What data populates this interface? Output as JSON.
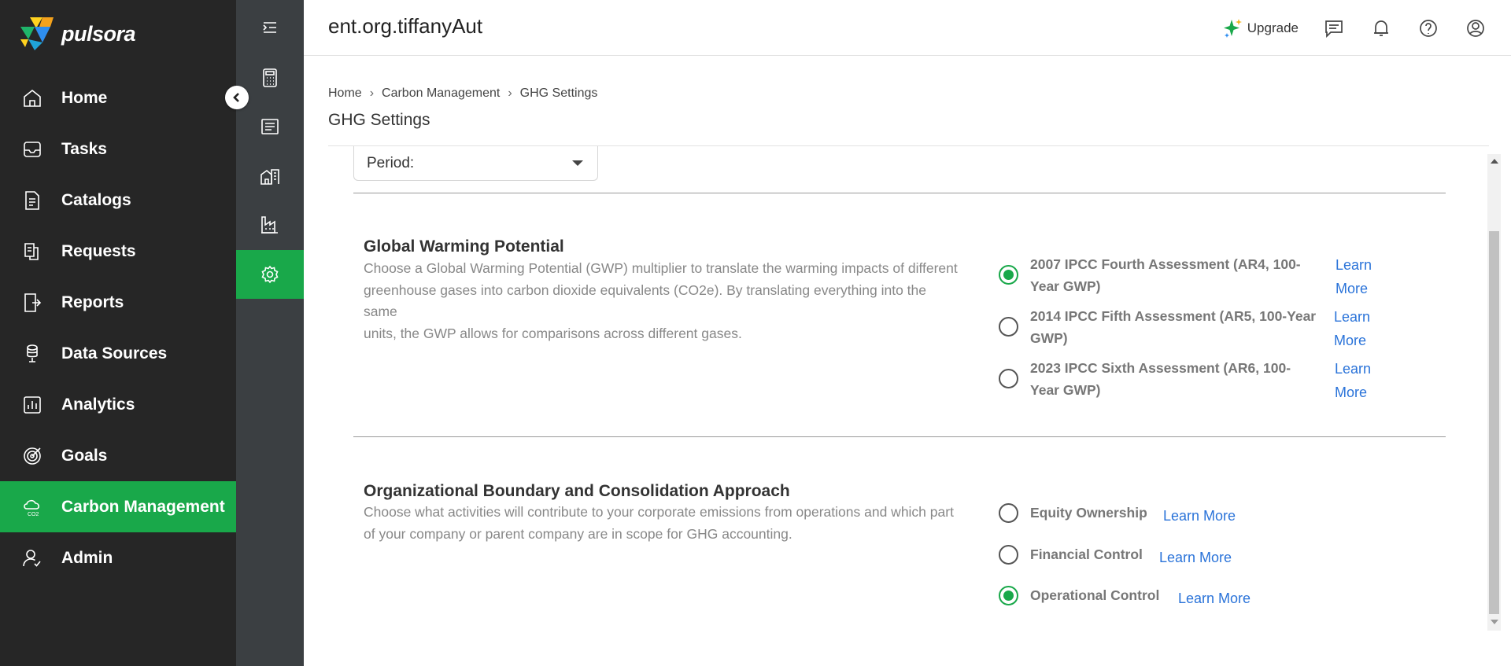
{
  "app": {
    "logo_text": "pulsora"
  },
  "sidebar": {
    "items": [
      {
        "label": "Home",
        "icon": "home-icon"
      },
      {
        "label": "Tasks",
        "icon": "inbox-icon"
      },
      {
        "label": "Catalogs",
        "icon": "catalog-icon"
      },
      {
        "label": "Requests",
        "icon": "requests-icon"
      },
      {
        "label": "Reports",
        "icon": "reports-icon"
      },
      {
        "label": "Data Sources",
        "icon": "database-icon"
      },
      {
        "label": "Analytics",
        "icon": "analytics-icon"
      },
      {
        "label": "Goals",
        "icon": "goals-icon"
      },
      {
        "label": "Carbon Management",
        "icon": "co2-icon",
        "active": true
      },
      {
        "label": "Admin",
        "icon": "admin-icon"
      }
    ]
  },
  "subbar": {
    "items": [
      {
        "icon": "collapse-menu-icon"
      },
      {
        "icon": "calculator-icon"
      },
      {
        "icon": "list-doc-icon"
      },
      {
        "icon": "buildings-icon"
      },
      {
        "icon": "factory-icon"
      },
      {
        "icon": "settings-gear-icon",
        "active": true
      }
    ]
  },
  "header": {
    "org_title": "ent.org.tiffanyAut",
    "upgrade_label": "Upgrade",
    "icons": [
      "chat-icon",
      "bell-icon",
      "help-icon",
      "user-icon"
    ]
  },
  "breadcrumb": {
    "items": [
      "Home",
      "Carbon Management",
      "GHG Settings"
    ]
  },
  "page": {
    "title": "GHG Settings"
  },
  "period": {
    "label": "Period:"
  },
  "gwp": {
    "title": "Global Warming Potential",
    "desc_lines": [
      "Choose a Global Warming Potential (GWP) multiplier to translate the warming impacts of different",
      "greenhouse gases into carbon dioxide equivalents (CO2e). By translating everything into the",
      "same",
      "units, the GWP allows for comparisons across different gases."
    ],
    "options": [
      {
        "line1": "2007 IPCC Fourth Assessment (AR4, 100-",
        "line2": "Year GWP)",
        "learn1": "Learn",
        "learn2": "More",
        "checked": true
      },
      {
        "line1": "2014 IPCC Fifth Assessment (AR5, 100-Year",
        "line2": "GWP)",
        "learn1": "Learn",
        "learn2": "More",
        "checked": false
      },
      {
        "line1": "2023 IPCC Sixth Assessment (AR6, 100-",
        "line2": "Year GWP)",
        "learn1": "Learn",
        "learn2": "More",
        "checked": false
      }
    ]
  },
  "boundary": {
    "title": "Organizational Boundary and Consolidation Approach",
    "desc_lines": [
      "Choose what activities will contribute to your corporate emissions from operations and which part",
      "of your company or parent company are in scope for GHG accounting."
    ],
    "options": [
      {
        "label": "Equity Ownership",
        "learn": "Learn More",
        "checked": false
      },
      {
        "label": "Financial Control",
        "learn": "Learn More",
        "checked": false
      },
      {
        "label": "Operational Control",
        "learn": "Learn More",
        "checked": true
      }
    ]
  },
  "colors": {
    "sidebar_bg": "#262626",
    "subbar_bg": "#3b3f42",
    "accent": "#19a84a",
    "link": "#2a73d9"
  }
}
